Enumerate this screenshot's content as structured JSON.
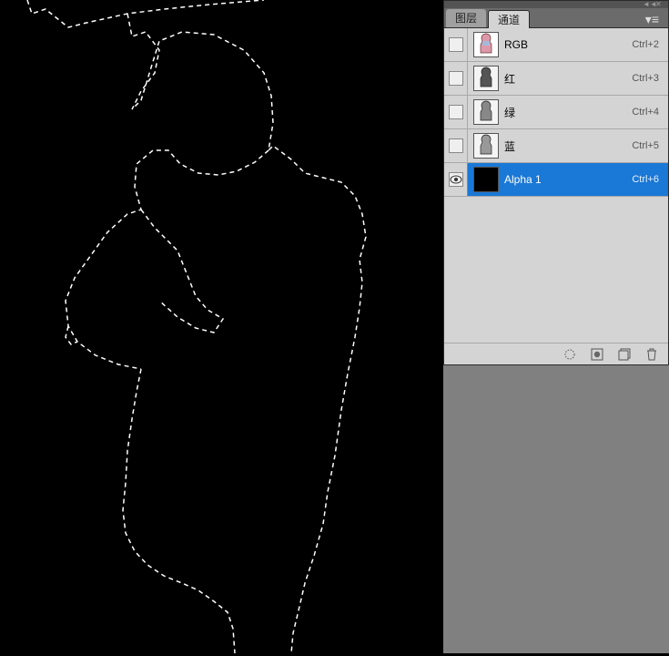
{
  "tabs": {
    "layers": "图层",
    "channels": "通道"
  },
  "channels": [
    {
      "name": "RGB",
      "shortcut": "Ctrl+2",
      "thumb": "color",
      "visible": false,
      "selected": false
    },
    {
      "name": "红",
      "shortcut": "Ctrl+3",
      "thumb": "mono",
      "visible": false,
      "selected": false
    },
    {
      "name": "绿",
      "shortcut": "Ctrl+4",
      "thumb": "mono",
      "visible": false,
      "selected": false
    },
    {
      "name": "蓝",
      "shortcut": "Ctrl+5",
      "thumb": "mono",
      "visible": false,
      "selected": false
    },
    {
      "name": "Alpha 1",
      "shortcut": "Ctrl+6",
      "thumb": "alpha",
      "visible": true,
      "selected": true
    }
  ],
  "footer_icons": {
    "load_selection": "load-selection",
    "save_selection": "save-selection-as-channel",
    "new_channel": "new-channel",
    "delete_channel": "delete-channel"
  }
}
